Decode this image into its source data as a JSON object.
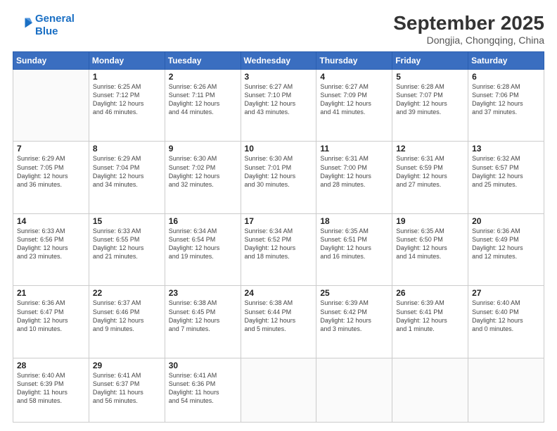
{
  "logo": {
    "line1": "General",
    "line2": "Blue"
  },
  "title": "September 2025",
  "subtitle": "Dongjia, Chongqing, China",
  "weekdays": [
    "Sunday",
    "Monday",
    "Tuesday",
    "Wednesday",
    "Thursday",
    "Friday",
    "Saturday"
  ],
  "weeks": [
    [
      {
        "day": "",
        "info": ""
      },
      {
        "day": "1",
        "info": "Sunrise: 6:25 AM\nSunset: 7:12 PM\nDaylight: 12 hours\nand 46 minutes."
      },
      {
        "day": "2",
        "info": "Sunrise: 6:26 AM\nSunset: 7:11 PM\nDaylight: 12 hours\nand 44 minutes."
      },
      {
        "day": "3",
        "info": "Sunrise: 6:27 AM\nSunset: 7:10 PM\nDaylight: 12 hours\nand 43 minutes."
      },
      {
        "day": "4",
        "info": "Sunrise: 6:27 AM\nSunset: 7:09 PM\nDaylight: 12 hours\nand 41 minutes."
      },
      {
        "day": "5",
        "info": "Sunrise: 6:28 AM\nSunset: 7:07 PM\nDaylight: 12 hours\nand 39 minutes."
      },
      {
        "day": "6",
        "info": "Sunrise: 6:28 AM\nSunset: 7:06 PM\nDaylight: 12 hours\nand 37 minutes."
      }
    ],
    [
      {
        "day": "7",
        "info": "Sunrise: 6:29 AM\nSunset: 7:05 PM\nDaylight: 12 hours\nand 36 minutes."
      },
      {
        "day": "8",
        "info": "Sunrise: 6:29 AM\nSunset: 7:04 PM\nDaylight: 12 hours\nand 34 minutes."
      },
      {
        "day": "9",
        "info": "Sunrise: 6:30 AM\nSunset: 7:02 PM\nDaylight: 12 hours\nand 32 minutes."
      },
      {
        "day": "10",
        "info": "Sunrise: 6:30 AM\nSunset: 7:01 PM\nDaylight: 12 hours\nand 30 minutes."
      },
      {
        "day": "11",
        "info": "Sunrise: 6:31 AM\nSunset: 7:00 PM\nDaylight: 12 hours\nand 28 minutes."
      },
      {
        "day": "12",
        "info": "Sunrise: 6:31 AM\nSunset: 6:59 PM\nDaylight: 12 hours\nand 27 minutes."
      },
      {
        "day": "13",
        "info": "Sunrise: 6:32 AM\nSunset: 6:57 PM\nDaylight: 12 hours\nand 25 minutes."
      }
    ],
    [
      {
        "day": "14",
        "info": "Sunrise: 6:33 AM\nSunset: 6:56 PM\nDaylight: 12 hours\nand 23 minutes."
      },
      {
        "day": "15",
        "info": "Sunrise: 6:33 AM\nSunset: 6:55 PM\nDaylight: 12 hours\nand 21 minutes."
      },
      {
        "day": "16",
        "info": "Sunrise: 6:34 AM\nSunset: 6:54 PM\nDaylight: 12 hours\nand 19 minutes."
      },
      {
        "day": "17",
        "info": "Sunrise: 6:34 AM\nSunset: 6:52 PM\nDaylight: 12 hours\nand 18 minutes."
      },
      {
        "day": "18",
        "info": "Sunrise: 6:35 AM\nSunset: 6:51 PM\nDaylight: 12 hours\nand 16 minutes."
      },
      {
        "day": "19",
        "info": "Sunrise: 6:35 AM\nSunset: 6:50 PM\nDaylight: 12 hours\nand 14 minutes."
      },
      {
        "day": "20",
        "info": "Sunrise: 6:36 AM\nSunset: 6:49 PM\nDaylight: 12 hours\nand 12 minutes."
      }
    ],
    [
      {
        "day": "21",
        "info": "Sunrise: 6:36 AM\nSunset: 6:47 PM\nDaylight: 12 hours\nand 10 minutes."
      },
      {
        "day": "22",
        "info": "Sunrise: 6:37 AM\nSunset: 6:46 PM\nDaylight: 12 hours\nand 9 minutes."
      },
      {
        "day": "23",
        "info": "Sunrise: 6:38 AM\nSunset: 6:45 PM\nDaylight: 12 hours\nand 7 minutes."
      },
      {
        "day": "24",
        "info": "Sunrise: 6:38 AM\nSunset: 6:44 PM\nDaylight: 12 hours\nand 5 minutes."
      },
      {
        "day": "25",
        "info": "Sunrise: 6:39 AM\nSunset: 6:42 PM\nDaylight: 12 hours\nand 3 minutes."
      },
      {
        "day": "26",
        "info": "Sunrise: 6:39 AM\nSunset: 6:41 PM\nDaylight: 12 hours\nand 1 minute."
      },
      {
        "day": "27",
        "info": "Sunrise: 6:40 AM\nSunset: 6:40 PM\nDaylight: 12 hours\nand 0 minutes."
      }
    ],
    [
      {
        "day": "28",
        "info": "Sunrise: 6:40 AM\nSunset: 6:39 PM\nDaylight: 11 hours\nand 58 minutes."
      },
      {
        "day": "29",
        "info": "Sunrise: 6:41 AM\nSunset: 6:37 PM\nDaylight: 11 hours\nand 56 minutes."
      },
      {
        "day": "30",
        "info": "Sunrise: 6:41 AM\nSunset: 6:36 PM\nDaylight: 11 hours\nand 54 minutes."
      },
      {
        "day": "",
        "info": ""
      },
      {
        "day": "",
        "info": ""
      },
      {
        "day": "",
        "info": ""
      },
      {
        "day": "",
        "info": ""
      }
    ]
  ]
}
